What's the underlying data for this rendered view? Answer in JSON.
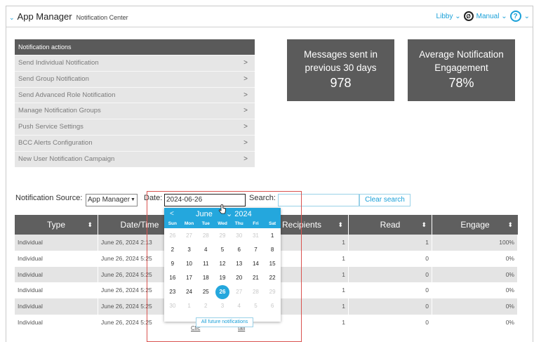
{
  "header": {
    "title": "App Manager",
    "subtitle": "Notification Center",
    "user": "Libby",
    "mode": "Manual",
    "help_glyph": "?",
    "user_glyph": "Ø",
    "chevron": "⌄",
    "title_chevron": "⌄"
  },
  "actions": {
    "heading": "Notification actions",
    "arrow": ">",
    "items": [
      "Send Individual Notification",
      "Send Group Notification",
      "Send Advanced Role Notification",
      "Manage Notification Groups",
      "Push Service Settings",
      "BCC Alerts Configuration",
      "New User Notification Campaign"
    ]
  },
  "stats": [
    {
      "label_line1": "Messages sent in",
      "label_line2": "previous 30 days",
      "value": "978"
    },
    {
      "label_line1": "Average Notification",
      "label_line2": "Engagement",
      "value": "78%"
    }
  ],
  "filters": {
    "source_label": "Notification Source:",
    "source_value": "App Manager",
    "date_label": "Date:",
    "date_value": "2024-06-26",
    "search_label": "Search:",
    "search_value": "",
    "clear_label": "Clear search"
  },
  "table": {
    "headers": [
      "Type",
      "Date/Time",
      "",
      "Recipients",
      "Read",
      "Engage"
    ],
    "sort_glyph": "⬍",
    "rows": [
      {
        "type": "Individual",
        "datetime": "June 26, 2024  2:13",
        "recipients": "1",
        "read": "1",
        "engage": "100%"
      },
      {
        "type": "Individual",
        "datetime": "June 26, 2024  5:25",
        "recipients": "1",
        "read": "0",
        "engage": "0%"
      },
      {
        "type": "Individual",
        "datetime": "June 26, 2024  5:25",
        "recipients": "1",
        "read": "0",
        "engage": "0%"
      },
      {
        "type": "Individual",
        "datetime": "June 26, 2024  5:25",
        "recipients": "1",
        "read": "0",
        "engage": "0%"
      },
      {
        "type": "Individual",
        "datetime": "June 26, 2024  5:25",
        "recipients": "1",
        "read": "0",
        "engage": "0%"
      },
      {
        "type": "Individual",
        "datetime": "June 26, 2024  5:25",
        "recipients": "1",
        "read": "0",
        "engage": "0%"
      }
    ],
    "partial_link_1": "Clic",
    "partial_link_2": "tail"
  },
  "calendar": {
    "month": "June",
    "year": "2024",
    "prev_glyph": "<",
    "dows": [
      "Sun",
      "Mon",
      "Tue",
      "Wed",
      "Thu",
      "Fri",
      "Sat"
    ],
    "weeks": [
      [
        {
          "d": "26",
          "dim": true
        },
        {
          "d": "27",
          "dim": true
        },
        {
          "d": "28",
          "dim": true
        },
        {
          "d": "29",
          "dim": true
        },
        {
          "d": "30",
          "dim": true
        },
        {
          "d": "31",
          "dim": true
        },
        {
          "d": "1"
        }
      ],
      [
        {
          "d": "2"
        },
        {
          "d": "3"
        },
        {
          "d": "4"
        },
        {
          "d": "5"
        },
        {
          "d": "6"
        },
        {
          "d": "7"
        },
        {
          "d": "8"
        }
      ],
      [
        {
          "d": "9"
        },
        {
          "d": "10"
        },
        {
          "d": "11"
        },
        {
          "d": "12"
        },
        {
          "d": "13"
        },
        {
          "d": "14"
        },
        {
          "d": "15"
        }
      ],
      [
        {
          "d": "16"
        },
        {
          "d": "17"
        },
        {
          "d": "18"
        },
        {
          "d": "19"
        },
        {
          "d": "20"
        },
        {
          "d": "21"
        },
        {
          "d": "22"
        }
      ],
      [
        {
          "d": "23"
        },
        {
          "d": "24"
        },
        {
          "d": "25"
        },
        {
          "d": "26",
          "sel": true
        },
        {
          "d": "27",
          "dim": true
        },
        {
          "d": "28",
          "dim": true
        },
        {
          "d": "29",
          "dim": true
        }
      ],
      [
        {
          "d": "30",
          "dim": true
        },
        {
          "d": "1",
          "dim": true
        },
        {
          "d": "2",
          "dim": true
        },
        {
          "d": "3",
          "dim": true
        },
        {
          "d": "4",
          "dim": true
        },
        {
          "d": "5",
          "dim": true
        },
        {
          "d": "6",
          "dim": true
        }
      ]
    ],
    "footer": "All future notifications"
  },
  "colors": {
    "accent": "#24a7dd",
    "highlight": "#d9534f",
    "panel": "#5b5b5b"
  }
}
